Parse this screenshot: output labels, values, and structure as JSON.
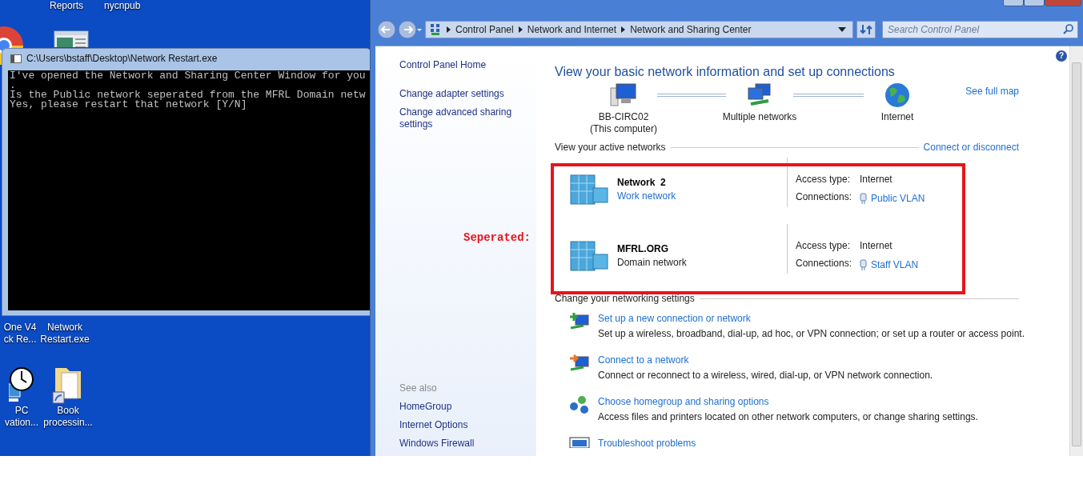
{
  "desktop": {
    "icons": [
      {
        "kind": "chrome"
      },
      {
        "kind": "window"
      },
      {
        "kind": "blank",
        "lines": [
          "One V4",
          "ck Re..."
        ]
      },
      {
        "kind": "blank",
        "lines": [
          "Network",
          "Restart.exe"
        ]
      },
      {
        "kind": "clock",
        "lines": [
          "PC",
          "vation..."
        ]
      },
      {
        "kind": "folder",
        "lines": [
          "Book",
          "processin..."
        ]
      }
    ],
    "top_labels": [
      "Reports",
      "nycnpub"
    ]
  },
  "console": {
    "title": "C:\\Users\\bstaff\\Desktop\\Network Restart.exe",
    "lines": [
      "I've opened the Network and Sharing Center Window for you",
      ".",
      "Is the Public network seperated from the MFRL Domain netw",
      "Yes, please restart that network [Y/N]"
    ]
  },
  "annotation": {
    "text": "Seperated:"
  },
  "explorer": {
    "breadcrumbs": [
      "Control Panel",
      "Network and Internet",
      "Network and Sharing Center"
    ],
    "search": {
      "placeholder": "Search Control Panel"
    },
    "help_label": "?",
    "nav": {
      "links": [
        "Control Panel Home",
        "Change adapter settings",
        "Change advanced sharing settings"
      ],
      "see_also": "See also",
      "see_also_links": [
        "HomeGroup",
        "Internet Options",
        "Windows Firewall"
      ]
    },
    "heading": "View your basic network information and set up connections",
    "see_full_map": "See full map",
    "map": [
      {
        "kind": "computer",
        "label": "BB-CIRC02",
        "sublabel": "(This computer)"
      },
      {
        "kind": "networks",
        "label": "Multiple networks"
      },
      {
        "kind": "globe",
        "label": "Internet"
      }
    ],
    "active_heading": "View your active networks",
    "connect_link": "Connect or disconnect",
    "networks": [
      {
        "name": "Network  2",
        "type": "Work network",
        "type_link": true,
        "access_label": "Access type:",
        "access": "Internet",
        "connections_label": "Connections:",
        "connection": "Public VLAN"
      },
      {
        "name": "MFRL.ORG",
        "type": "Domain network",
        "type_link": false,
        "access_label": "Access type:",
        "access": "Internet",
        "connections_label": "Connections:",
        "connection": "Staff VLAN"
      }
    ],
    "settings_heading": "Change your networking settings",
    "tasks": [
      {
        "kind": "new",
        "title": "Set up a new connection or network",
        "description": "Set up a wireless, broadband, dial-up, ad hoc, or VPN connection; or set up a router or access point."
      },
      {
        "kind": "connect",
        "title": "Connect to a network",
        "description": "Connect or reconnect to a wireless, wired, dial-up, or VPN network connection."
      },
      {
        "kind": "homegroup",
        "title": "Choose homegroup and sharing options",
        "description": "Access files and printers located on other network computers, or change sharing settings."
      },
      {
        "kind": "troubleshoot",
        "title": "Troubleshoot problems"
      }
    ]
  }
}
